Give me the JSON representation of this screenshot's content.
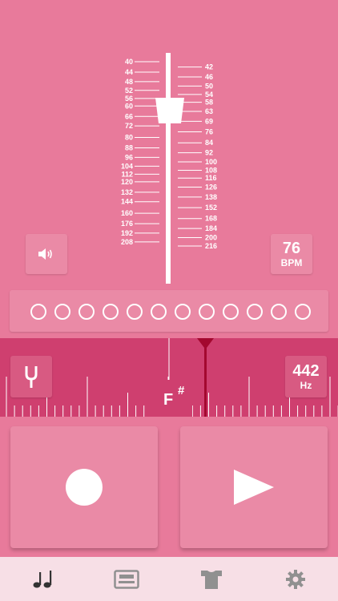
{
  "metronome": {
    "left_ticks": [
      "40",
      "44",
      "48",
      "52",
      "56",
      "60",
      "66",
      "72",
      "80",
      "88",
      "96",
      "104",
      "112",
      "120",
      "132",
      "144",
      "160",
      "176",
      "192",
      "208"
    ],
    "right_ticks": [
      "42",
      "46",
      "50",
      "54",
      "58",
      "63",
      "69",
      "76",
      "84",
      "92",
      "100",
      "108",
      "116",
      "126",
      "138",
      "152",
      "168",
      "184",
      "200",
      "216"
    ],
    "bpm_value": "76",
    "bpm_unit": "BPM",
    "beat_count": 12
  },
  "tuner": {
    "hz_value": "442",
    "hz_unit": "Hz",
    "note": "F",
    "accidental": "#"
  },
  "icons": {
    "sound": "speaker-icon",
    "fork": "tuning-fork-icon",
    "record": "record-icon",
    "play": "play-icon",
    "tabs": [
      "music-note-icon",
      "cassette-icon",
      "shirt-icon",
      "gear-icon"
    ]
  },
  "colors": {
    "background": "#e87a9b",
    "tuner_band": "#cf3f6f",
    "needle": "#a3082f",
    "tab_bar": "#f7dfe6",
    "tab_active": "#333333",
    "tab_inactive": "#909090"
  }
}
